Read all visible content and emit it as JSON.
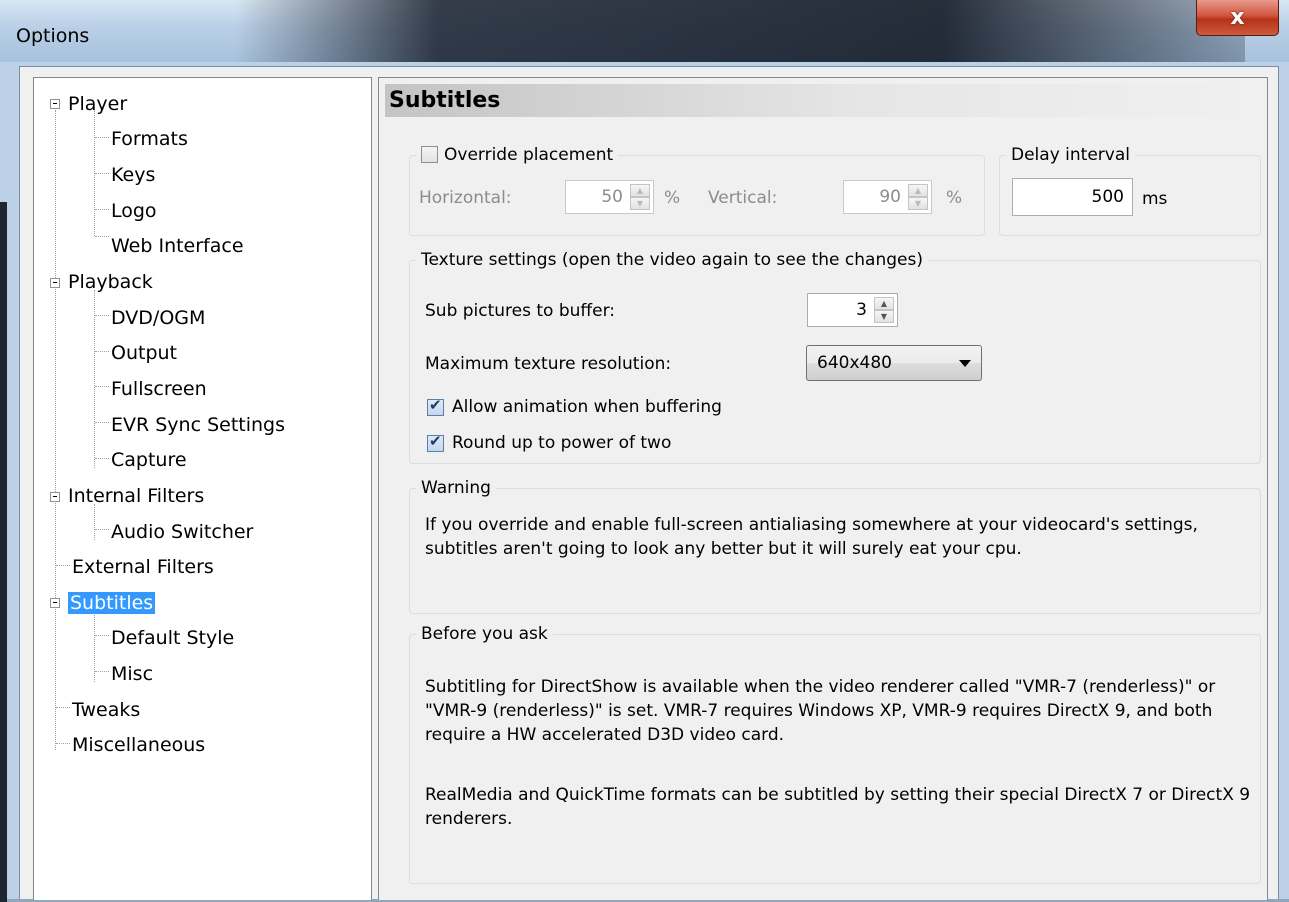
{
  "window": {
    "title": "Options",
    "close_glyph": "x"
  },
  "tree": {
    "items": [
      {
        "label": "Player"
      },
      {
        "label": "Formats"
      },
      {
        "label": "Keys"
      },
      {
        "label": "Logo"
      },
      {
        "label": "Web Interface"
      },
      {
        "label": "Playback"
      },
      {
        "label": "DVD/OGM"
      },
      {
        "label": "Output"
      },
      {
        "label": "Fullscreen"
      },
      {
        "label": "EVR Sync Settings"
      },
      {
        "label": "Capture"
      },
      {
        "label": "Internal Filters"
      },
      {
        "label": "Audio Switcher"
      },
      {
        "label": "External Filters"
      },
      {
        "label": "Subtitles",
        "selected": true
      },
      {
        "label": "Default Style"
      },
      {
        "label": "Misc"
      },
      {
        "label": "Tweaks"
      },
      {
        "label": "Miscellaneous"
      }
    ],
    "selection_color": "#3399ff"
  },
  "panel": {
    "heading": "Subtitles",
    "placement": {
      "checkbox_label": "Override placement",
      "checked": false,
      "horizontal_label": "Horizontal:",
      "horizontal_value": "50",
      "horizontal_unit": "%",
      "vertical_label": "Vertical:",
      "vertical_value": "90",
      "vertical_unit": "%"
    },
    "delay": {
      "title": "Delay interval",
      "value": "500",
      "unit": "ms"
    },
    "texture": {
      "title": "Texture settings (open the video again to see the changes)",
      "sub_pictures_label": "Sub pictures to buffer:",
      "sub_pictures_value": "3",
      "max_res_label": "Maximum texture resolution:",
      "max_res_value": "640x480",
      "allow_animation_label": "Allow animation when buffering",
      "allow_animation_checked": true,
      "round_up_label": "Round up to power of two",
      "round_up_checked": true
    },
    "warning": {
      "title": "Warning",
      "text": "If you override and enable full-screen antialiasing somewhere at your videocard's settings, subtitles aren't going to look any better but it will surely eat your cpu."
    },
    "before_ask": {
      "title": "Before you ask",
      "text1": "Subtitling for DirectShow is available when the video renderer called \"VMR-7 (renderless)\" or \"VMR-9 (renderless)\" is set. VMR-7 requires Windows XP, VMR-9 requires DirectX 9, and both require a HW accelerated D3D video card.",
      "text2": "RealMedia and QuickTime formats can be subtitled by setting their special DirectX 7 or DirectX 9 renderers."
    }
  }
}
